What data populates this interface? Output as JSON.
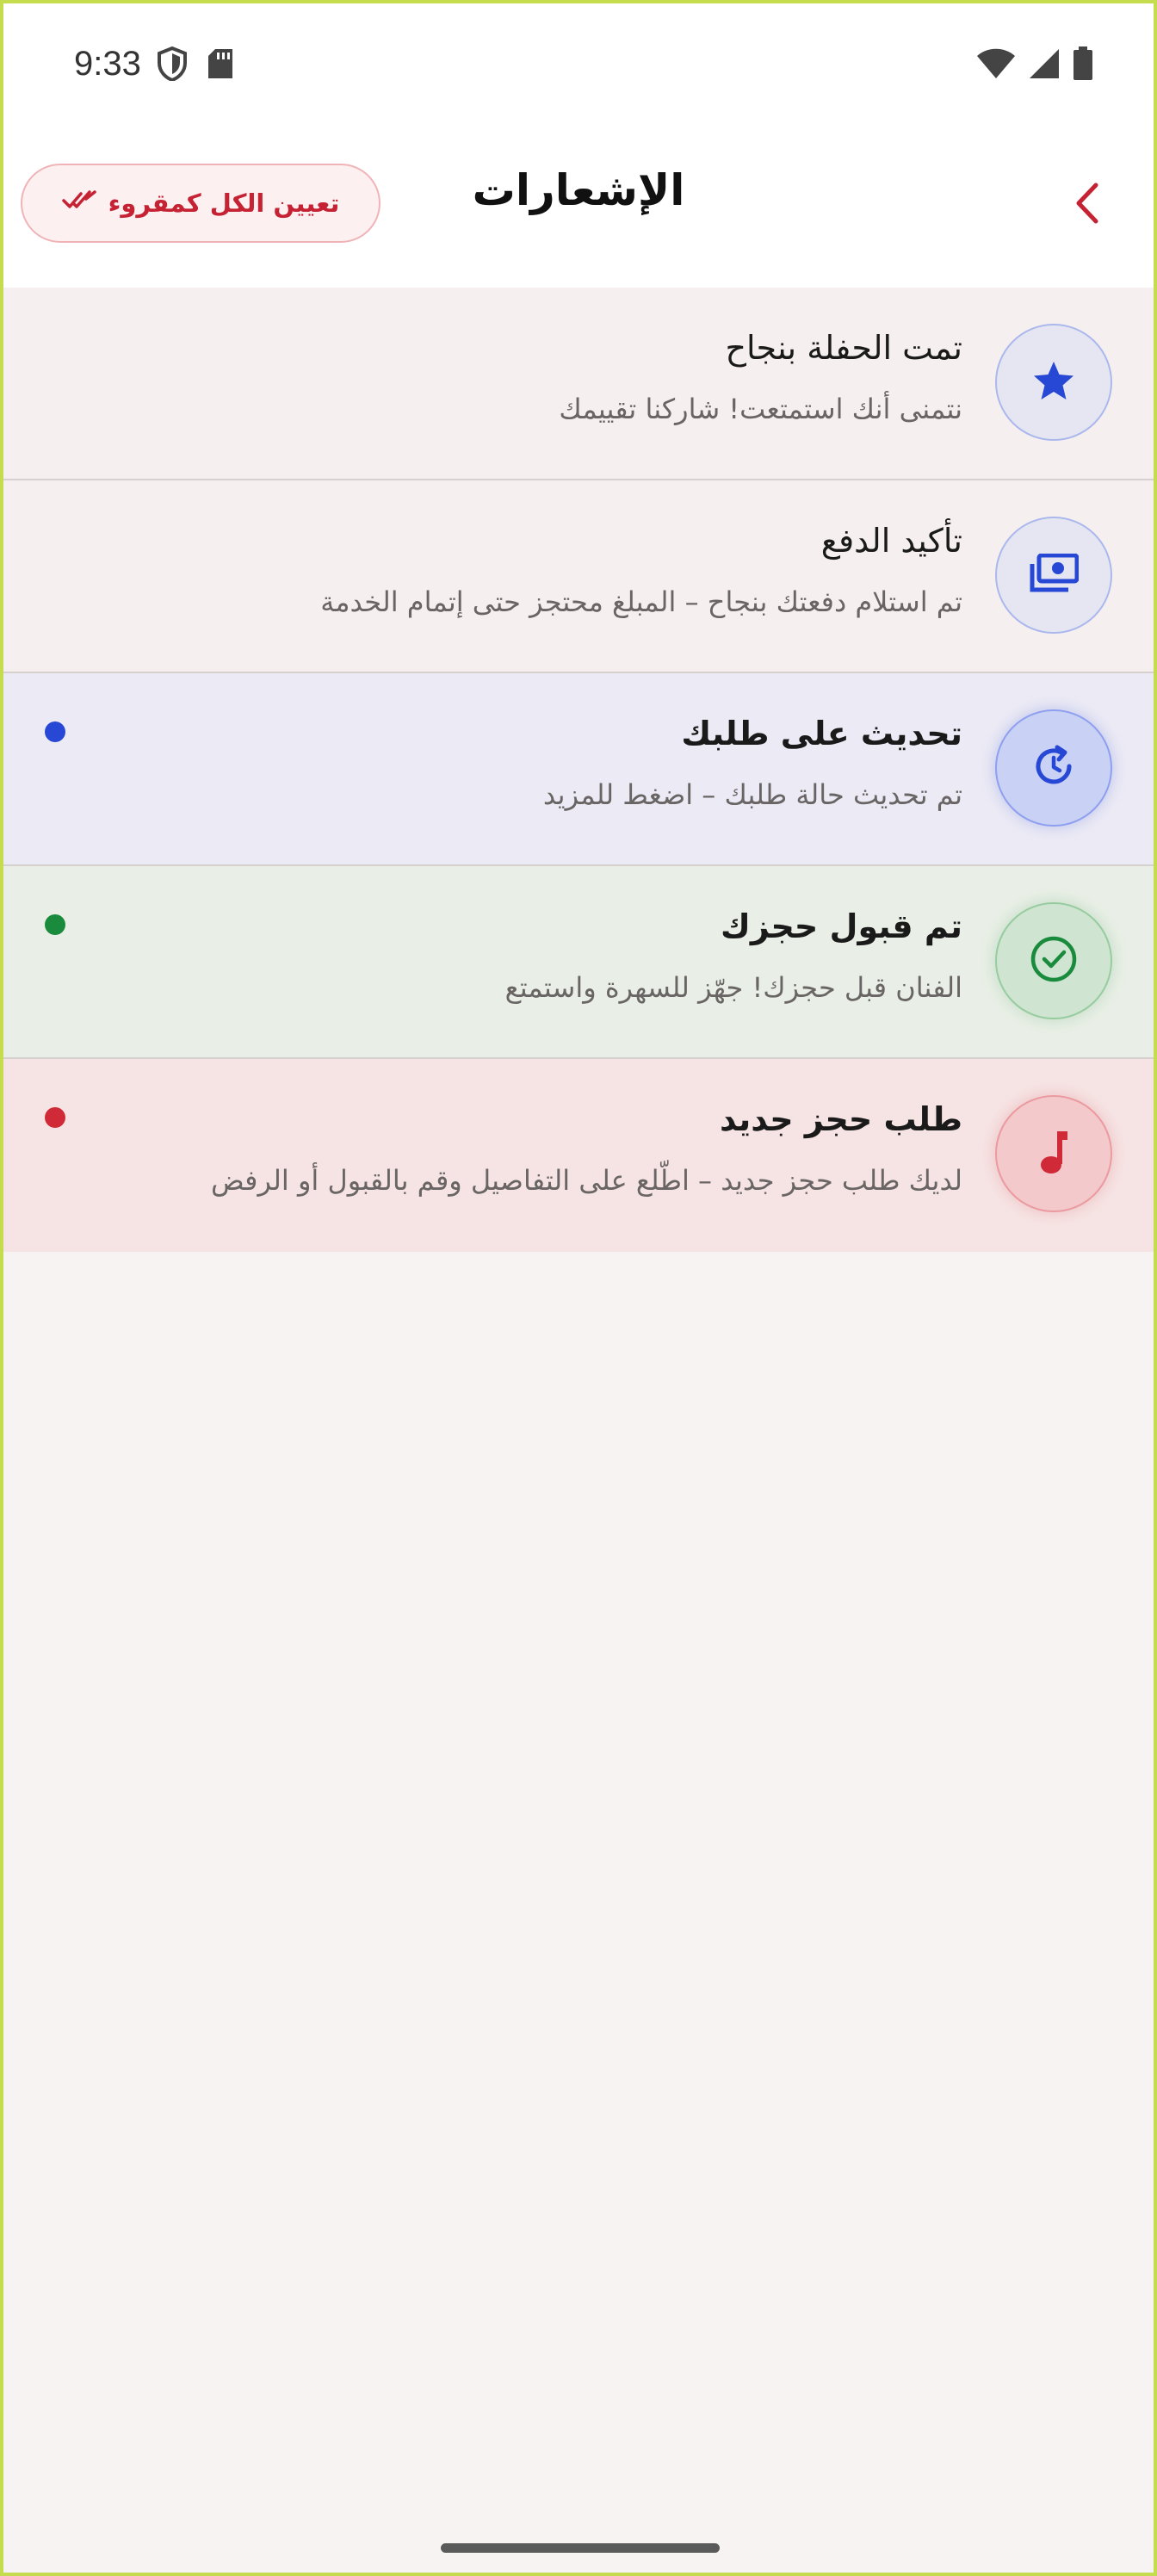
{
  "status_bar": {
    "time": "9:33",
    "left_icons": [
      "shield-icon",
      "sd-card-icon"
    ],
    "right_icons": [
      "wifi-icon",
      "signal-icon",
      "battery-icon"
    ]
  },
  "header": {
    "title": "الإشعارات",
    "mark_all_label": "تعيين الكل كمقروء",
    "back_icon": "chevron-left-icon",
    "accent_color": "#c52233"
  },
  "notifications": [
    {
      "title": "تمت الحفلة بنجاح",
      "body": "نتمنى أنك استمتعت! شاركنا تقييمك",
      "icon": "star-icon",
      "unread": false,
      "accent": "#2748d4",
      "row_bg": "#f5f0ef"
    },
    {
      "title": "تأكيد الدفع",
      "body": "تم استلام دفعتك بنجاح – المبلغ محتجز حتى إتمام الخدمة",
      "icon": "payments-icon",
      "unread": false,
      "accent": "#2748d4",
      "row_bg": "#f5f0ef"
    },
    {
      "title": "تحديث على طلبك",
      "body": "تم تحديث حالة طلبك – اضغط للمزيد",
      "icon": "update-icon",
      "unread": true,
      "accent": "#2748d4",
      "row_bg": "#ecebf5"
    },
    {
      "title": "تم قبول حجزك",
      "body": "الفنان قبل حجزك! جهّز للسهرة واستمتع",
      "icon": "check-circle-icon",
      "unread": true,
      "accent": "#1a8a3c",
      "row_bg": "#e9efe6"
    },
    {
      "title": "طلب حجز جديد",
      "body": "لديك طلب حجز جديد – اطّلع على التفاصيل وقم بالقبول أو الرفض",
      "icon": "music-note-icon",
      "unread": true,
      "accent": "#d02a38",
      "row_bg": "#f6e4e4"
    }
  ]
}
